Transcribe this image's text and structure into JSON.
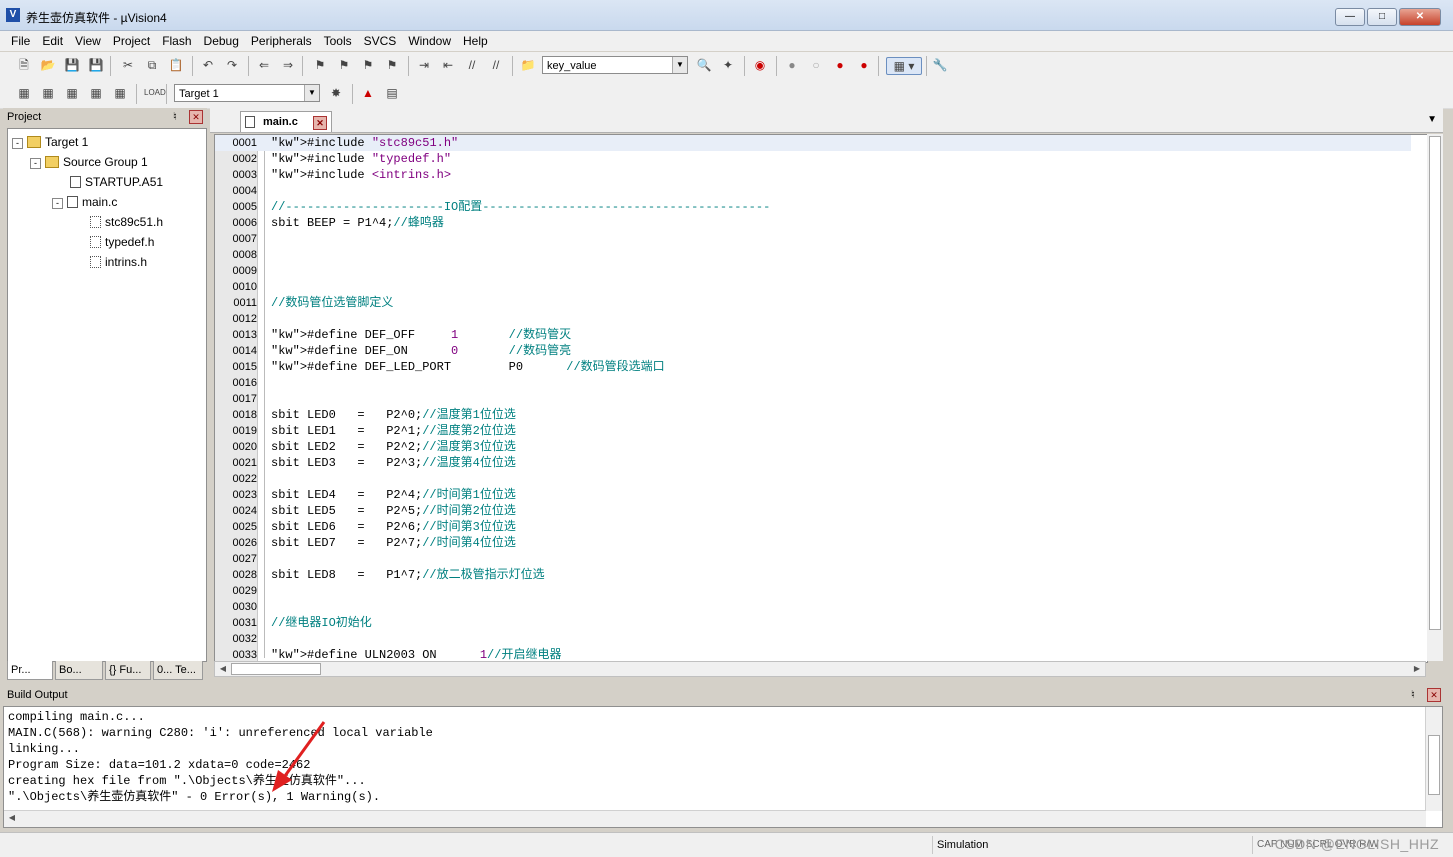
{
  "window": {
    "title": "养生壶仿真软件 - µVision4",
    "controls": [
      "minimize",
      "maximize",
      "close"
    ]
  },
  "menu": [
    "File",
    "Edit",
    "View",
    "Project",
    "Flash",
    "Debug",
    "Peripherals",
    "Tools",
    "SVCS",
    "Window",
    "Help"
  ],
  "toolbar": {
    "find_combo_value": "key_value",
    "target_combo_value": "Target 1"
  },
  "project_panel": {
    "title": "Project",
    "tree": {
      "target": "Target 1",
      "group": "Source Group 1",
      "files": [
        "STARTUP.A51",
        "main.c"
      ],
      "includes": [
        "stc89c51.h",
        "typedef.h",
        "intrins.h"
      ]
    },
    "tabs": [
      "Pr...",
      "Bo...",
      "{} Fu...",
      "0... Te..."
    ]
  },
  "editor": {
    "tab_label": "main.c",
    "lines": [
      {
        "n": "0001",
        "t": "#include \"stc89c51.h\""
      },
      {
        "n": "0002",
        "t": "#include \"typedef.h\""
      },
      {
        "n": "0003",
        "t": "#include <intrins.h>"
      },
      {
        "n": "0004",
        "t": ""
      },
      {
        "n": "0005",
        "t": "//----------------------IO配置----------------------------------------"
      },
      {
        "n": "0006",
        "t": "sbit BEEP = P1^4;//蜂鸣器"
      },
      {
        "n": "0007",
        "t": ""
      },
      {
        "n": "0008",
        "t": ""
      },
      {
        "n": "0009",
        "t": ""
      },
      {
        "n": "0010",
        "t": ""
      },
      {
        "n": "0011",
        "t": "//数码管位选管脚定义"
      },
      {
        "n": "0012",
        "t": ""
      },
      {
        "n": "0013",
        "t": "#define DEF_OFF     1       //数码管灭"
      },
      {
        "n": "0014",
        "t": "#define DEF_ON      0       //数码管亮"
      },
      {
        "n": "0015",
        "t": "#define DEF_LED_PORT        P0      //数码管段选端口"
      },
      {
        "n": "0016",
        "t": ""
      },
      {
        "n": "0017",
        "t": ""
      },
      {
        "n": "0018",
        "t": "sbit LED0   =   P2^0;//温度第1位位选"
      },
      {
        "n": "0019",
        "t": "sbit LED1   =   P2^1;//温度第2位位选"
      },
      {
        "n": "0020",
        "t": "sbit LED2   =   P2^2;//温度第3位位选"
      },
      {
        "n": "0021",
        "t": "sbit LED3   =   P2^3;//温度第4位位选"
      },
      {
        "n": "0022",
        "t": ""
      },
      {
        "n": "0023",
        "t": "sbit LED4   =   P2^4;//时间第1位位选"
      },
      {
        "n": "0024",
        "t": "sbit LED5   =   P2^5;//时间第2位位选"
      },
      {
        "n": "0025",
        "t": "sbit LED6   =   P2^6;//时间第3位位选"
      },
      {
        "n": "0026",
        "t": "sbit LED7   =   P2^7;//时间第4位位选"
      },
      {
        "n": "0027",
        "t": ""
      },
      {
        "n": "0028",
        "t": "sbit LED8   =   P1^7;//放二极管指示灯位选"
      },
      {
        "n": "0029",
        "t": ""
      },
      {
        "n": "0030",
        "t": ""
      },
      {
        "n": "0031",
        "t": "//继电器IO初始化"
      },
      {
        "n": "0032",
        "t": ""
      },
      {
        "n": "0033",
        "t": "#define ULN2003 ON      1//开启继电器"
      }
    ]
  },
  "build_output": {
    "title": "Build Output",
    "lines": [
      "compiling main.c...",
      "MAIN.C(568): warning C280: 'i': unreferenced local variable",
      "linking...",
      "Program Size: data=101.2 xdata=0 code=2462",
      "creating hex file from \".\\Objects\\养生壶仿真软件\"...",
      "\".\\Objects\\养生壶仿真软件\" - 0 Error(s), 1 Warning(s)."
    ]
  },
  "status": {
    "mode": "Simulation",
    "indicators": "CAP  NUM  SCRL  OVR  R/W",
    "watermark": "CSDN @ENGLISH_HHZ"
  },
  "colors": {
    "keyword": "#0000ff",
    "comment": "#008080",
    "string": "#800080",
    "annotation_arrow": "#e02020"
  }
}
